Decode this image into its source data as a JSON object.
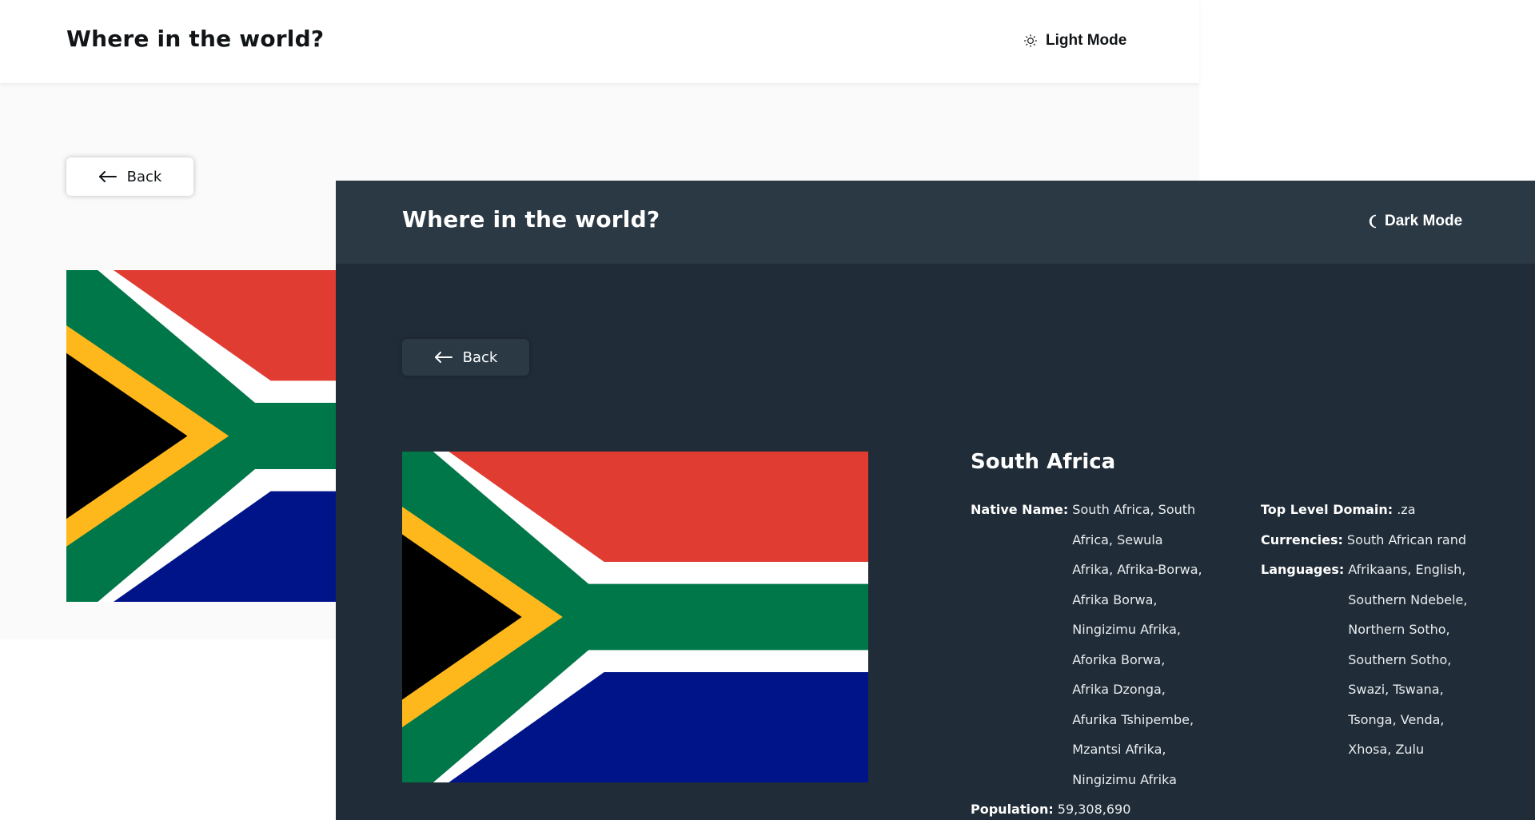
{
  "light": {
    "title": "Where in the world?",
    "mode_label": "Light Mode",
    "mode_icon": "sun-icon",
    "back_label": "Back",
    "back_icon": "arrow-left-icon"
  },
  "dark": {
    "title": "Where in the world?",
    "mode_label": "Dark Mode",
    "mode_icon": "moon-icon",
    "back_label": "Back",
    "back_icon": "arrow-left-icon",
    "country": {
      "name": "South Africa",
      "native_name_label": "Native Name:",
      "native_name": "South Africa, South Africa, Sewula Afrika, Afrika-Borwa, Afrika Borwa, Ningizimu Afrika, Aforika Borwa, Afrika Dzonga, Afurika Tshipembe, Mzantsi Afrika, Ningizimu Afrika",
      "population_label": "Population:",
      "population": "59,308,690",
      "top_level_domain_label": "Top Level Domain:",
      "top_level_domain": ".za",
      "currencies_label": "Currencies:",
      "currencies": "South African rand",
      "languages_label": "Languages:",
      "languages": "Afrikaans, English, Southern Ndebele, Northern Sotho, Southern Sotho, Swazi, Tswana, Tsonga, Venda, Xhosa, Zulu"
    }
  },
  "flag_colors": {
    "red": "#e03c31",
    "blue": "#001489",
    "green": "#007749",
    "gold": "#ffb81c",
    "black": "#000000",
    "white": "#ffffff"
  },
  "theme_colors": {
    "light_bg": "#fafafa",
    "light_elements": "#ffffff",
    "dark_bg": "#202c37",
    "dark_elements": "#2b3945"
  }
}
